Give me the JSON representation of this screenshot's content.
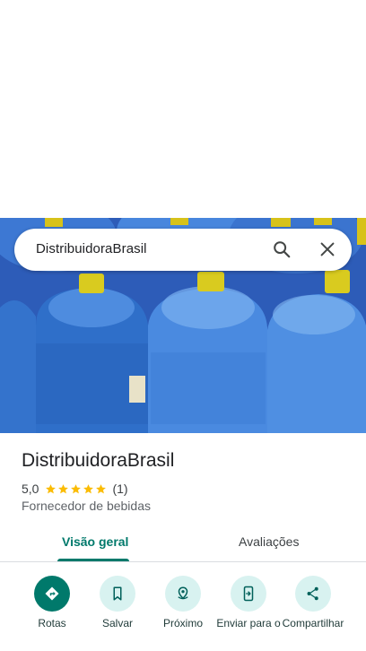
{
  "search": {
    "query": "DistribuidoraBrasil"
  },
  "place": {
    "name": "DistribuidoraBrasil",
    "rating": "5,0",
    "review_count": "(1)",
    "stars": 5,
    "category": "Fornecedor de bebidas"
  },
  "tabs": [
    {
      "label": "Visão geral",
      "active": true
    },
    {
      "label": "Avaliações",
      "active": false
    }
  ],
  "actions": [
    {
      "label": "Rotas",
      "icon": "directions-icon"
    },
    {
      "label": "Salvar",
      "icon": "bookmark-icon"
    },
    {
      "label": "Próximo",
      "icon": "nearby-icon"
    },
    {
      "label": "Enviar para o",
      "icon": "send-to-phone-icon"
    },
    {
      "label": "Compartilhar",
      "icon": "share-icon"
    }
  ],
  "colors": {
    "accent": "#00796b",
    "action_bg": "#d8f2f0",
    "star": "#fbbc04"
  }
}
